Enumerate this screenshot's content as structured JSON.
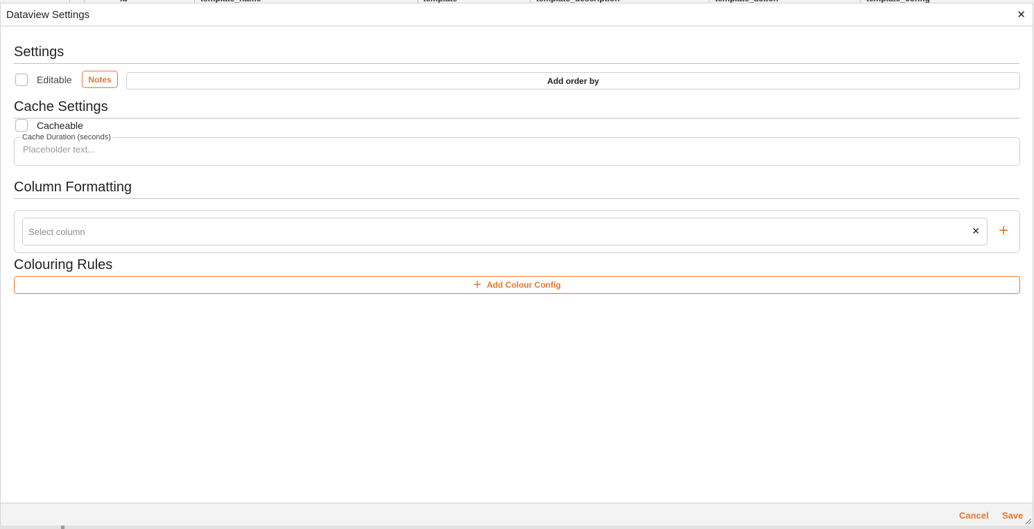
{
  "background": {
    "columns": [
      "id",
      "template_name",
      "template",
      "template_description",
      "template_action",
      "template_config"
    ]
  },
  "dialog": {
    "title": "Dataview Settings",
    "close_icon": "close-icon"
  },
  "settings": {
    "title": "Settings",
    "editable_label": "Editable",
    "editable_checked": false,
    "notes_label": "Notes",
    "order_by_label": "Add order by"
  },
  "cache": {
    "title": "Cache Settings",
    "cacheable_label": "Cacheable",
    "cacheable_checked": false,
    "duration_label": "Cache Duration (seconds)",
    "duration_placeholder": "Placeholder text...",
    "duration_value": ""
  },
  "column_formatting": {
    "title": "Column Formatting",
    "select_placeholder": "Select column",
    "clear_icon": "close-icon",
    "add_icon": "plus-icon"
  },
  "colouring_rules": {
    "title": "Colouring Rules",
    "add_label": "Add Colour Config",
    "add_icon": "plus-icon"
  },
  "footer": {
    "cancel_label": "Cancel",
    "save_label": "Save"
  },
  "colors": {
    "accent": "#e8772e",
    "border": "#cfcfcf",
    "footer_bg": "#f3f3f3"
  }
}
